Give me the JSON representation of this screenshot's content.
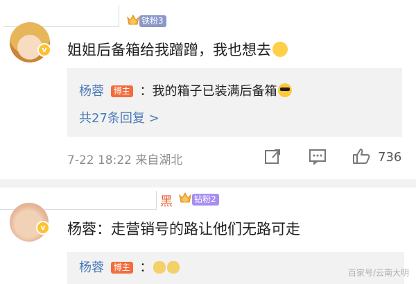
{
  "comments": [
    {
      "fan_badge": "铁粉3",
      "crown_level": "6",
      "text": "姐姐后备箱给我蹭蹭，我也想去",
      "reply": {
        "name": "杨蓉",
        "role_badge": "博主",
        "text": "：我的箱子已装满后备箱"
      },
      "more_replies": "共27条回复 >",
      "time_location": "7-22 18:22 来自湖北",
      "likes": "736"
    },
    {
      "name_suffix": "黑",
      "fan_badge": "钻粉2",
      "crown_level": "6",
      "text": "杨蓉：走营销号的路让他们无路可走",
      "reply": {
        "name": "杨蓉",
        "role_badge": "博主",
        "text": "："
      }
    }
  ],
  "watermark": "百家号/云南大明"
}
